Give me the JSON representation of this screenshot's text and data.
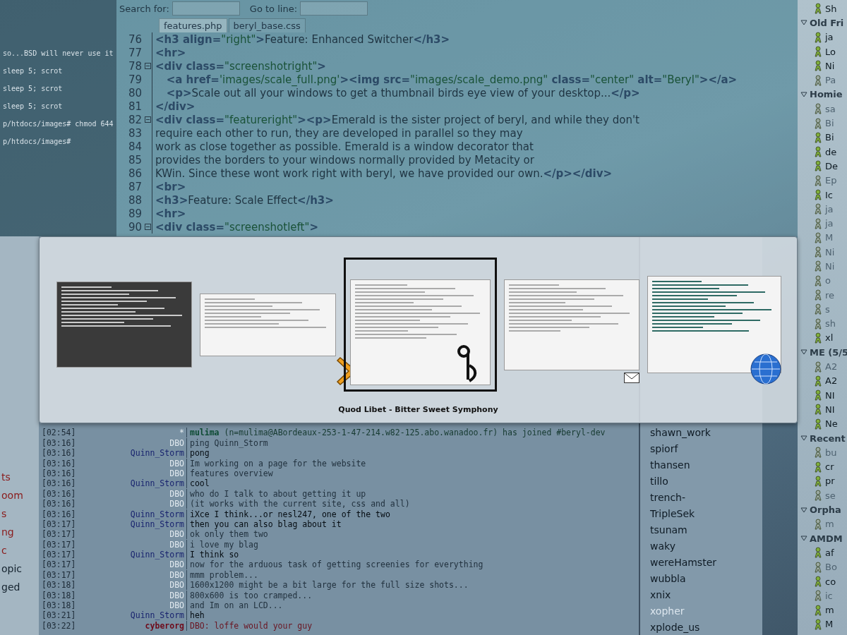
{
  "terminal": {
    "lines": [
      "so...BSD will never use it",
      "sleep 5; scrot",
      "sleep 5; scrot",
      "sleep 5; scrot",
      "p/htdocs/images# chmod 644",
      "p/htdocs/images#"
    ]
  },
  "editor": {
    "search_label": "Search for:",
    "goto_label": "Go to line:",
    "tabs": [
      {
        "label": "features.php",
        "selected": true
      },
      {
        "label": "beryl_base.css",
        "selected": false
      }
    ],
    "lines": [
      {
        "number": "76",
        "fold": false,
        "segments": [
          {
            "kind": "tag",
            "t": "<h3 align="
          },
          {
            "kind": "value",
            "t": "\"right\""
          },
          {
            "kind": "tag",
            "t": ">"
          },
          {
            "kind": "text",
            "t": "Feature: Enhanced Switcher"
          },
          {
            "kind": "tag",
            "t": "</h3>"
          }
        ]
      },
      {
        "number": "77",
        "fold": false,
        "segments": [
          {
            "kind": "tag",
            "t": "<hr>"
          }
        ]
      },
      {
        "number": "78",
        "fold": true,
        "segments": [
          {
            "kind": "tag",
            "t": "<div class="
          },
          {
            "kind": "value",
            "t": "\"screenshotright\""
          },
          {
            "kind": "tag",
            "t": ">"
          }
        ]
      },
      {
        "number": "79",
        "fold": false,
        "segments": [
          {
            "kind": "tag",
            "t": "   <a href="
          },
          {
            "kind": "value",
            "t": "'images/scale_full.png'"
          },
          {
            "kind": "tag",
            "t": "><img src="
          },
          {
            "kind": "value",
            "t": "\"images/scale_demo.png\""
          },
          {
            "kind": "tag",
            "t": " class="
          },
          {
            "kind": "value",
            "t": "\"center\""
          },
          {
            "kind": "tag",
            "t": " alt="
          },
          {
            "kind": "value",
            "t": "\"Beryl\""
          },
          {
            "kind": "tag",
            "t": "></a>"
          }
        ]
      },
      {
        "number": "80",
        "fold": false,
        "segments": [
          {
            "kind": "tag",
            "t": "   <p>"
          },
          {
            "kind": "text",
            "t": "Scale out all your windows to get a thumbnail birds eye view of your desktop..."
          },
          {
            "kind": "tag",
            "t": "</p>"
          }
        ]
      },
      {
        "number": "81",
        "fold": false,
        "segments": [
          {
            "kind": "tag",
            "t": "</div>"
          }
        ]
      },
      {
        "number": "82",
        "fold": true,
        "segments": [
          {
            "kind": "tag",
            "t": "<div class="
          },
          {
            "kind": "value",
            "t": "\"featureright\""
          },
          {
            "kind": "tag",
            "t": "><p>"
          },
          {
            "kind": "text",
            "t": "Emerald is the sister project of beryl, and while they don't"
          }
        ]
      },
      {
        "number": "83",
        "fold": false,
        "segments": [
          {
            "kind": "text",
            "t": "require each other to run, they are developed in parallel so they may"
          }
        ]
      },
      {
        "number": "84",
        "fold": false,
        "segments": [
          {
            "kind": "text",
            "t": "work as close together as possible. Emerald is a window decorator that"
          }
        ]
      },
      {
        "number": "85",
        "fold": false,
        "segments": [
          {
            "kind": "text",
            "t": "provides the borders to your windows normally provided by Metacity or"
          }
        ]
      },
      {
        "number": "86",
        "fold": false,
        "segments": [
          {
            "kind": "text",
            "t": "KWin. Since these wont work right with beryl, we have provided our own."
          },
          {
            "kind": "tag",
            "t": "</p></div>"
          }
        ]
      },
      {
        "number": "87",
        "fold": false,
        "segments": [
          {
            "kind": "tag",
            "t": "<br>"
          }
        ]
      },
      {
        "number": "88",
        "fold": false,
        "segments": [
          {
            "kind": "tag",
            "t": "<h3>"
          },
          {
            "kind": "text",
            "t": "Feature: Scale Effect"
          },
          {
            "kind": "tag",
            "t": "</h3>"
          }
        ]
      },
      {
        "number": "89",
        "fold": false,
        "segments": [
          {
            "kind": "tag",
            "t": "<hr>"
          }
        ]
      },
      {
        "number": "90",
        "fold": true,
        "segments": [
          {
            "kind": "tag",
            "t": "<div class="
          },
          {
            "kind": "value",
            "t": "\"screenshotleft\""
          },
          {
            "kind": "tag",
            "t": ">"
          }
        ]
      }
    ]
  },
  "sidebar": {
    "items": [
      {
        "label": "ts",
        "highlighted": true
      },
      {
        "label": "oom",
        "highlighted": true
      },
      {
        "label": "s",
        "highlighted": true
      },
      {
        "label": "ng",
        "highlighted": true
      },
      {
        "label": "c",
        "highlighted": true
      },
      {
        "label": "opic",
        "highlighted": false
      },
      {
        "label": "ged",
        "highlighted": false
      }
    ]
  },
  "chat": {
    "rows": [
      {
        "time": "[02:54]",
        "nick": "*",
        "kind": "event",
        "text": "**mulima** (n=mulima@ABordeaux-253-1-47-214.w82-125.abo.wanadoo.fr) has joined #beryl-dev"
      },
      {
        "time": "[03:16]",
        "nick": "DBO",
        "kind": "own",
        "text": "ping Quinn_Storm"
      },
      {
        "time": "[03:16]",
        "nick": "Quinn_Storm",
        "kind": "other",
        "text": "pong"
      },
      {
        "time": "[03:16]",
        "nick": "DBO",
        "kind": "own",
        "text": "Im working on a page for the website"
      },
      {
        "time": "[03:16]",
        "nick": "DBO",
        "kind": "own",
        "text": "features overview"
      },
      {
        "time": "[03:16]",
        "nick": "Quinn_Storm",
        "kind": "other",
        "text": "cool"
      },
      {
        "time": "[03:16]",
        "nick": "DBO",
        "kind": "own",
        "text": "who do I talk to about getting it up"
      },
      {
        "time": "[03:16]",
        "nick": "DBO",
        "kind": "own",
        "text": "(it works with the current site, css and all)"
      },
      {
        "time": "[03:16]",
        "nick": "Quinn_Storm",
        "kind": "other",
        "text": "iXce I think...or nesl247, one of the two"
      },
      {
        "time": "[03:17]",
        "nick": "Quinn_Storm",
        "kind": "other",
        "text": "then you can also blag about it"
      },
      {
        "time": "[03:17]",
        "nick": "DBO",
        "kind": "own",
        "text": "ok only them two"
      },
      {
        "time": "[03:17]",
        "nick": "DBO",
        "kind": "own",
        "text": "i love my blag"
      },
      {
        "time": "[03:17]",
        "nick": "Quinn_Storm",
        "kind": "other",
        "text": "I think so"
      },
      {
        "time": "[03:17]",
        "nick": "DBO",
        "kind": "own",
        "text": "now for the arduous task of getting screenies for everything"
      },
      {
        "time": "[03:17]",
        "nick": "DBO",
        "kind": "own",
        "text": "mmm problem..."
      },
      {
        "time": "[03:18]",
        "nick": "DBO",
        "kind": "own",
        "text": "1600x1200 might be a bit large for the full size shots..."
      },
      {
        "time": "[03:18]",
        "nick": "DBO",
        "kind": "own",
        "text": "800x600 is too cramped..."
      },
      {
        "time": "[03:18]",
        "nick": "DBO",
        "kind": "own",
        "text": "and Im on an LCD..."
      },
      {
        "time": "[03:21]",
        "nick": "Quinn_Storm",
        "kind": "other",
        "text": "heh"
      },
      {
        "time": "[03:22]",
        "nick": "cyberorg",
        "kind": "highlight",
        "text": "DBO: loffe would your guy"
      }
    ]
  },
  "users": [
    {
      "name": "shawn_work",
      "away": false
    },
    {
      "name": "spiorf",
      "away": false
    },
    {
      "name": "thansen",
      "away": false
    },
    {
      "name": "tillo",
      "away": false
    },
    {
      "name": "trench-",
      "away": false
    },
    {
      "name": "TripleSek",
      "away": false
    },
    {
      "name": "tsunam",
      "away": false
    },
    {
      "name": "waky",
      "away": false
    },
    {
      "name": "wereHamster",
      "away": false
    },
    {
      "name": "wubbla",
      "away": false
    },
    {
      "name": "xnix",
      "away": false
    },
    {
      "name": "xopher",
      "away": true
    },
    {
      "name": "xplode_us",
      "away": false
    }
  ],
  "buddy_list": [
    {
      "kind": "buddy",
      "name": "Sh",
      "idle": false
    },
    {
      "kind": "group",
      "name": "Old Fri",
      "expanded": true,
      "children": [
        {
          "name": "ja",
          "idle": false
        },
        {
          "name": "Lo",
          "idle": false
        },
        {
          "name": "Ni",
          "idle": false
        },
        {
          "name": "Pa",
          "idle": true
        }
      ]
    },
    {
      "kind": "group",
      "name": "Homie",
      "expanded": true,
      "children": [
        {
          "name": "sa",
          "idle": true
        },
        {
          "name": "Bi",
          "idle": true
        },
        {
          "name": "Bi",
          "idle": false
        },
        {
          "name": "de",
          "idle": false
        },
        {
          "name": "De",
          "idle": false
        },
        {
          "name": "Ep",
          "idle": true
        },
        {
          "name": "Ic",
          "idle": false
        },
        {
          "name": "ja",
          "idle": true
        },
        {
          "name": "ja",
          "idle": true
        },
        {
          "name": "M",
          "idle": true
        },
        {
          "name": "Ni",
          "idle": true
        },
        {
          "name": "Ni",
          "idle": true
        },
        {
          "name": "o",
          "idle": true
        },
        {
          "name": "re",
          "idle": true
        },
        {
          "name": "s",
          "idle": true
        },
        {
          "name": "sh",
          "idle": true
        },
        {
          "name": "xl",
          "idle": false
        }
      ]
    },
    {
      "kind": "group",
      "name": "ME (5/5",
      "expanded": true,
      "children": [
        {
          "name": "A2",
          "idle": true
        },
        {
          "name": "A2",
          "idle": false
        },
        {
          "name": "NI",
          "idle": false
        },
        {
          "name": "NI",
          "idle": false
        },
        {
          "name": "Ne",
          "idle": false
        }
      ]
    },
    {
      "kind": "group",
      "name": "Recent",
      "expanded": true,
      "children": [
        {
          "name": "bu",
          "idle": true
        },
        {
          "name": "cr",
          "idle": false
        },
        {
          "name": "pr",
          "idle": false
        },
        {
          "name": "se",
          "idle": true
        }
      ]
    },
    {
      "kind": "group",
      "name": "Orpha",
      "expanded": true,
      "children": [
        {
          "name": "m",
          "idle": true
        }
      ]
    },
    {
      "kind": "group",
      "name": "AMDM",
      "expanded": true,
      "children": [
        {
          "name": "af",
          "idle": false
        },
        {
          "name": "Bo",
          "idle": true
        },
        {
          "name": "co",
          "idle": false
        },
        {
          "name": "ic",
          "idle": true
        },
        {
          "name": "m",
          "idle": false
        },
        {
          "name": "M",
          "idle": false
        }
      ]
    }
  ],
  "switcher": {
    "caption": "Quod Libet - Bitter Sweet Symphony",
    "windows": [
      {
        "kind": "terminal",
        "selected": false
      },
      {
        "kind": "editor",
        "selected": false
      },
      {
        "kind": "player",
        "selected": true
      },
      {
        "kind": "document",
        "selected": false
      },
      {
        "kind": "browser",
        "selected": false
      }
    ]
  }
}
